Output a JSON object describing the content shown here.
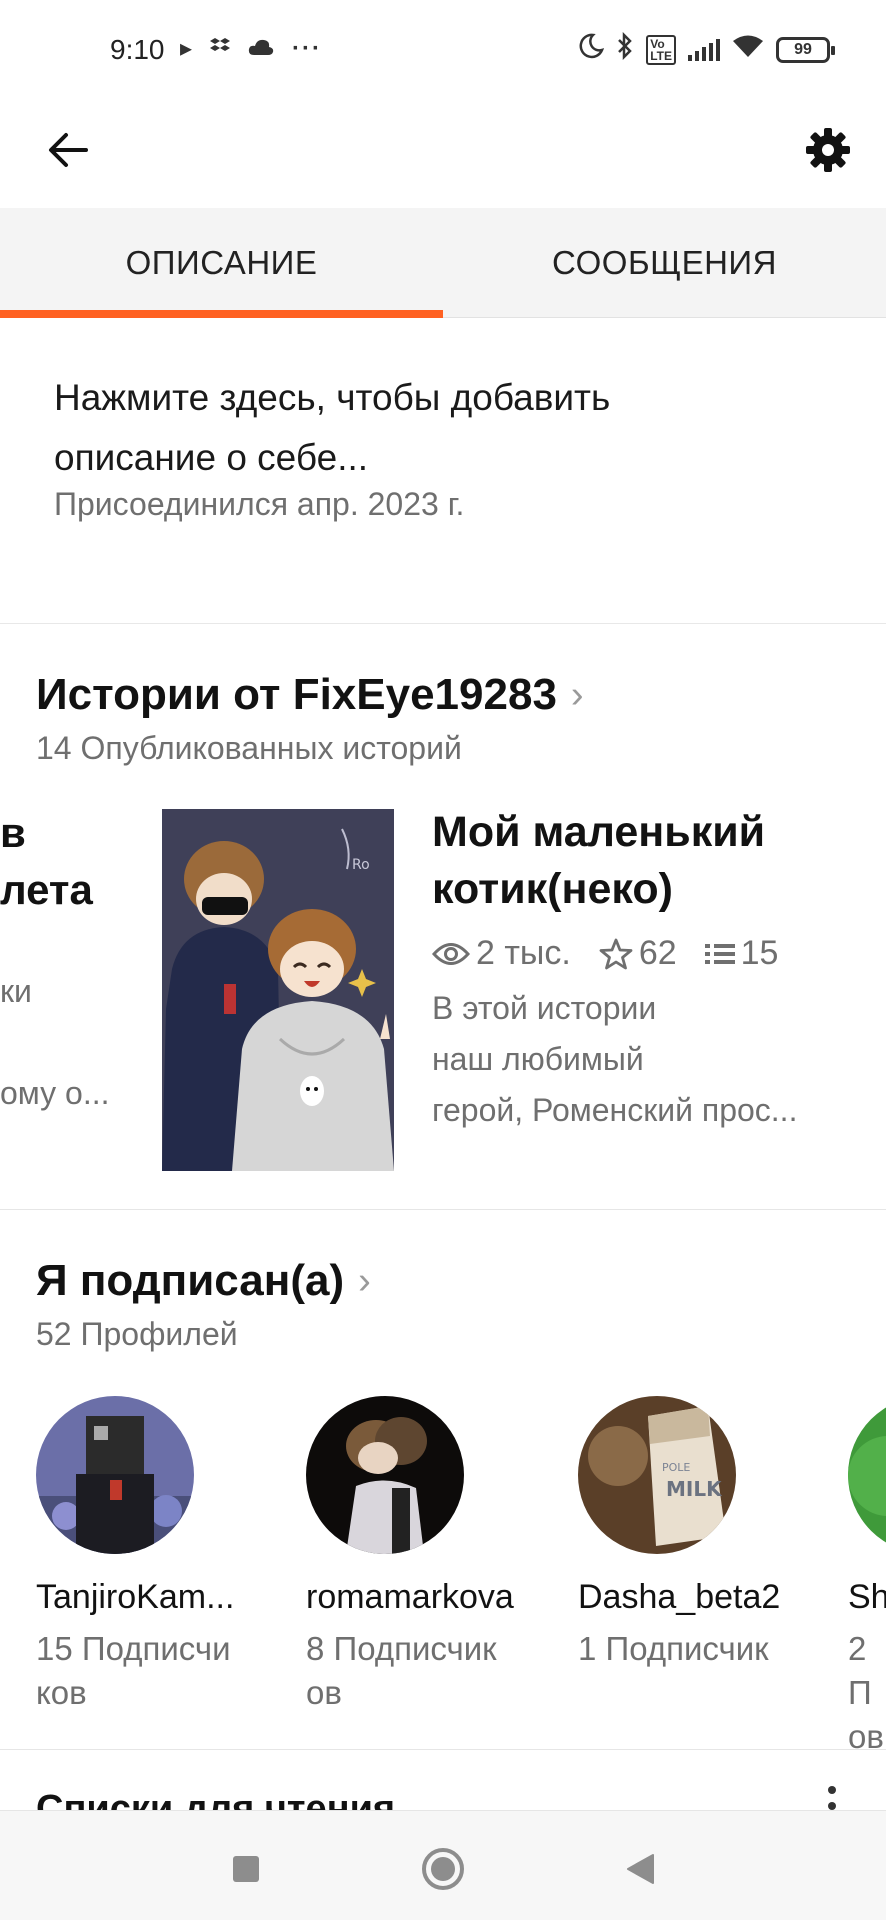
{
  "status_bar": {
    "time": "9:10",
    "battery": "99"
  },
  "tabs": [
    {
      "label": "ОПИСАНИЕ",
      "active": true
    },
    {
      "label": "СООБЩЕНИЯ",
      "active": false
    }
  ],
  "description": {
    "prompt_line1": "Нажмите здесь, чтобы добавить",
    "prompt_line2": "описание о себе...",
    "joined": "Присоединился апр. 2023 г."
  },
  "stories": {
    "title": "Истории от FixEye19283",
    "subtitle": "14 Опубликованных историй",
    "prev_card": {
      "title_line1": "в",
      "title_line2": "лета",
      "desc_line1": "ки",
      "desc_line2": "ому о..."
    },
    "card": {
      "title": "Мой маленький котик(неко)",
      "reads": "2 тыс.",
      "votes": "62",
      "parts": "15",
      "desc_line1": "В этой истории",
      "desc_line2": "наш любимый",
      "desc_line3": "герой, Роменский прос..."
    }
  },
  "following": {
    "title": "Я подписан(а)",
    "subtitle": "52 Профилей",
    "profiles": [
      {
        "name": "TanjiroKam...",
        "followers_line1": "15 Подписчи",
        "followers_line2": "ков"
      },
      {
        "name": "romamarkova",
        "followers_line1": "8 Подписчик",
        "followers_line2": "ов"
      },
      {
        "name": "Dasha_beta2",
        "followers_line1": "1 Подписчик",
        "followers_line2": ""
      },
      {
        "name": "Sh",
        "followers_line1": "2 П",
        "followers_line2": "ов"
      }
    ]
  },
  "reading_lists": {
    "title": "Списки для чтения"
  },
  "colors": {
    "accent": "#ff6122",
    "muted_text": "#6f6f6f"
  },
  "icons": [
    "back-arrow-icon",
    "gear-icon",
    "eye-icon",
    "star-icon",
    "list-icon",
    "more-vert-icon",
    "stop-icon",
    "home-icon",
    "back-triangle-icon"
  ]
}
